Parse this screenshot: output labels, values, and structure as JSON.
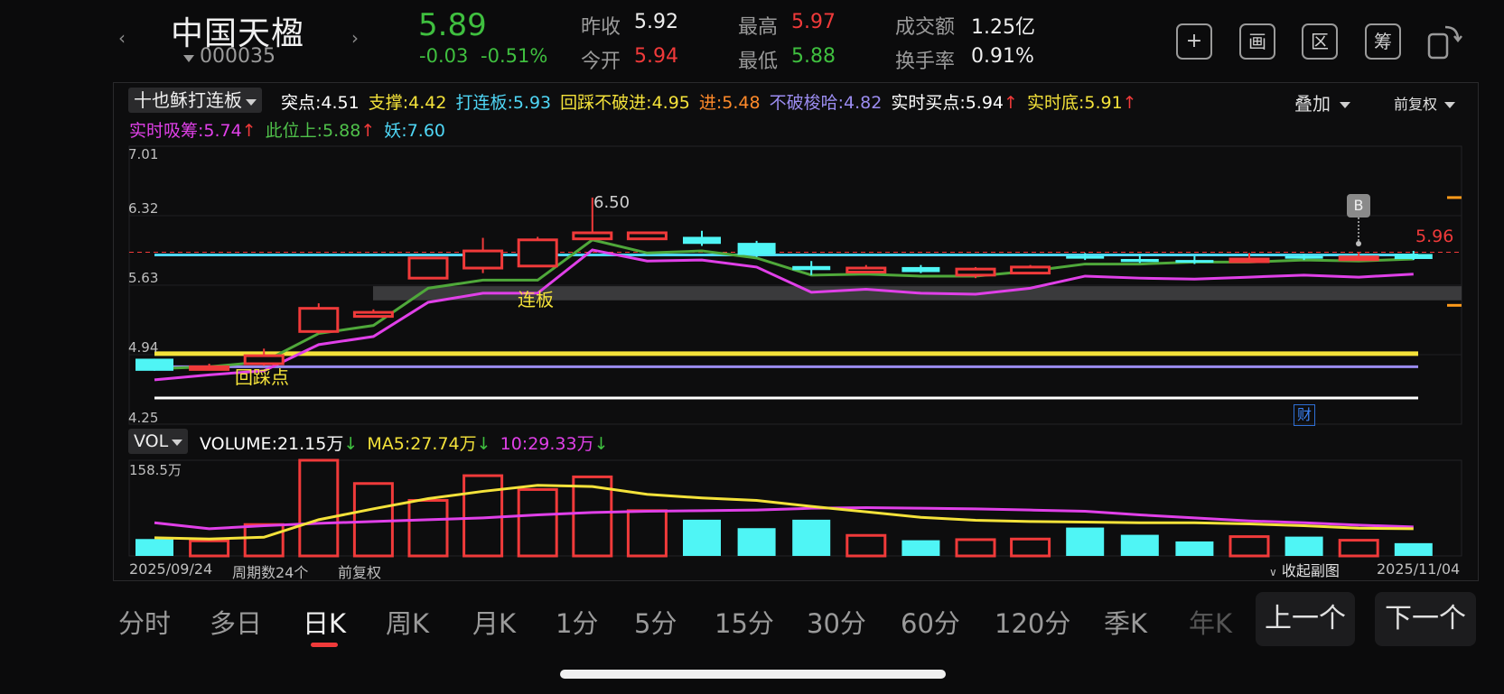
{
  "header": {
    "name": "中国天楹",
    "code": "000035",
    "price": "5.89",
    "change": "-0.03",
    "change_pct": "-0.51%",
    "prev_close_label": "昨收",
    "prev_close": "5.92",
    "open_label": "今开",
    "open": "5.94",
    "high_label": "最高",
    "high": "5.97",
    "low_label": "最低",
    "low": "5.88",
    "turnover_label": "成交额",
    "turnover": "1.25亿",
    "turnover_rate_label": "换手率",
    "turnover_rate": "0.91%"
  },
  "toolbar": {
    "icons": [
      "add-watchlist-icon",
      "layout-icon",
      "region-icon",
      "chip-icon",
      "rotate-screen-icon"
    ],
    "add_glyph": "+",
    "layout_glyph": "画",
    "region_glyph": "区",
    "chip_glyph": "筹"
  },
  "indicator": {
    "name": "十也稣打连板",
    "overlay_label": "叠加",
    "adjust_label": "前复权",
    "row1": [
      {
        "label": "突点:",
        "value": "4.51",
        "color": "#ffffff",
        "arrow": ""
      },
      {
        "label": "支撑:",
        "value": "4.42",
        "color": "#f4e23a",
        "arrow": ""
      },
      {
        "label": "打连板:",
        "value": "5.93",
        "color": "#4fd6f5",
        "arrow": ""
      },
      {
        "label": "回踩不破进:",
        "value": "4.95",
        "color": "#f4e23a",
        "arrow": ""
      },
      {
        "label": "进:",
        "value": "5.48",
        "color": "#ff8a2a",
        "arrow": ""
      },
      {
        "label": "不破梭哈:",
        "value": "4.82",
        "color": "#9b8cf0",
        "arrow": ""
      },
      {
        "label": "实时买点:",
        "value": "5.94",
        "color": "#ffffff",
        "arrow": "↑"
      },
      {
        "label": "实时底:",
        "value": "5.91",
        "color": "#f4e23a",
        "arrow": "↑"
      }
    ],
    "row2": [
      {
        "label": "实时吸筹:",
        "value": "5.74",
        "color": "#e040e8",
        "arrow": "↑"
      },
      {
        "label": "此位上:",
        "value": "5.88",
        "color": "#4fc04a",
        "arrow": "↑"
      },
      {
        "label": "妖:",
        "value": "7.60",
        "color": "#4fd6f5",
        "arrow": ""
      }
    ]
  },
  "price_chart": {
    "y_ticks": [
      "7.01",
      "6.32",
      "5.63",
      "4.94",
      "4.25"
    ],
    "high_annotation": "6.50",
    "current_price_tag": "5.96",
    "label_lianban": "连板",
    "label_huicai": "回踩点",
    "badge_b": "B",
    "badge_cai": "财"
  },
  "volume": {
    "selector": "VOL",
    "volume_label": "VOLUME:",
    "volume_value": "21.15万",
    "volume_arrow": "↓",
    "ma5_label": "MA5:",
    "ma5_value": "27.74万",
    "ma5_arrow": "↓",
    "ma10_label": "10:",
    "ma10_value": "29.33万",
    "ma10_arrow": "↓",
    "max_label": "158.5万"
  },
  "footer": {
    "start_date": "2025/09/24",
    "period_count": "周期数24个",
    "adjust": "前复权",
    "collapse": "收起副图",
    "end_date": "2025/11/04"
  },
  "tabs": [
    "分时",
    "多日",
    "日K",
    "周K",
    "月K",
    "1分",
    "5分",
    "15分",
    "30分",
    "60分",
    "120分",
    "季K",
    "年K"
  ],
  "active_tab": "日K",
  "buttons": {
    "prev": "上一个",
    "next": "下一个"
  },
  "chart_data": {
    "type": "candlestick",
    "ylim": [
      4.25,
      7.01
    ],
    "date_range": [
      "2025/09/24",
      "2025/11/04"
    ],
    "candles": [
      {
        "o": 4.9,
        "c": 4.78,
        "h": 4.9,
        "l": 4.78
      },
      {
        "o": 4.82,
        "c": 4.82,
        "h": 4.85,
        "l": 4.8
      },
      {
        "o": 4.85,
        "c": 4.93,
        "h": 5.0,
        "l": 4.83
      },
      {
        "o": 5.17,
        "c": 5.4,
        "h": 5.45,
        "l": 5.15
      },
      {
        "o": 5.32,
        "c": 5.36,
        "h": 5.39,
        "l": 5.31
      },
      {
        "o": 5.7,
        "c": 5.9,
        "h": 5.9,
        "l": 5.7
      },
      {
        "o": 5.8,
        "c": 5.97,
        "h": 6.1,
        "l": 5.75
      },
      {
        "o": 5.82,
        "c": 6.08,
        "h": 6.11,
        "l": 5.82
      },
      {
        "o": 6.09,
        "c": 6.15,
        "h": 6.5,
        "l": 6.09
      },
      {
        "o": 6.09,
        "c": 6.15,
        "h": 6.16,
        "l": 6.08
      },
      {
        "o": 6.11,
        "c": 6.04,
        "h": 6.17,
        "l": 6.02
      },
      {
        "o": 6.05,
        "c": 5.93,
        "h": 6.07,
        "l": 5.91
      },
      {
        "o": 5.82,
        "c": 5.78,
        "h": 5.87,
        "l": 5.73
      },
      {
        "o": 5.76,
        "c": 5.8,
        "h": 5.83,
        "l": 5.75
      },
      {
        "o": 5.81,
        "c": 5.76,
        "h": 5.83,
        "l": 5.75
      },
      {
        "o": 5.73,
        "c": 5.79,
        "h": 5.81,
        "l": 5.7
      },
      {
        "o": 5.75,
        "c": 5.81,
        "h": 5.83,
        "l": 5.74
      },
      {
        "o": 5.92,
        "c": 5.9,
        "h": 5.95,
        "l": 5.88
      },
      {
        "o": 5.89,
        "c": 5.86,
        "h": 5.94,
        "l": 5.85
      },
      {
        "o": 5.88,
        "c": 5.86,
        "h": 5.92,
        "l": 5.84
      },
      {
        "o": 5.89,
        "c": 5.89,
        "h": 5.95,
        "l": 5.86
      },
      {
        "o": 5.92,
        "c": 5.9,
        "h": 5.94,
        "l": 5.88
      },
      {
        "o": 5.89,
        "c": 5.91,
        "h": 5.95,
        "l": 5.88
      },
      {
        "o": 5.94,
        "c": 5.89,
        "h": 5.97,
        "l": 5.88
      }
    ],
    "green_line": [
      4.8,
      4.82,
      4.87,
      5.15,
      5.23,
      5.6,
      5.68,
      5.68,
      6.08,
      5.95,
      5.97,
      5.9,
      5.73,
      5.74,
      5.72,
      5.72,
      5.77,
      5.84,
      5.84,
      5.86,
      5.86,
      5.88,
      5.87,
      5.89
    ],
    "magenta_line": [
      4.69,
      4.74,
      4.78,
      5.04,
      5.12,
      5.46,
      5.55,
      5.55,
      5.98,
      5.87,
      5.88,
      5.81,
      5.56,
      5.59,
      5.55,
      5.54,
      5.6,
      5.72,
      5.7,
      5.69,
      5.71,
      5.73,
      5.71,
      5.74
    ],
    "horizontal_levels": [
      {
        "value": 5.93,
        "color": "#4fd6f5"
      },
      {
        "value": 4.95,
        "color": "#f4e23a"
      },
      {
        "value": 4.82,
        "color": "#9b8cf0"
      },
      {
        "value": 4.51,
        "color": "#ffffff"
      }
    ],
    "band": [
      5.48,
      5.62
    ],
    "volume": {
      "max": 158.5,
      "values": [
        28,
        25,
        52,
        158.5,
        120,
        92,
        133,
        110,
        131,
        75,
        60,
        46,
        60,
        34,
        26,
        27,
        28,
        47,
        35,
        24,
        32,
        32,
        26,
        21.15
      ],
      "ma5": [
        30,
        28,
        31,
        60,
        78,
        95,
        107,
        117,
        115,
        102,
        96,
        92,
        82,
        73,
        64,
        59,
        57,
        56,
        55,
        55,
        53,
        50,
        46,
        45
      ],
      "ma10": [
        55,
        45,
        50,
        54,
        57,
        60,
        63,
        68,
        72,
        74,
        75,
        76,
        79,
        80,
        79,
        78,
        76,
        74,
        68,
        63,
        58,
        55,
        51,
        48
      ]
    }
  }
}
